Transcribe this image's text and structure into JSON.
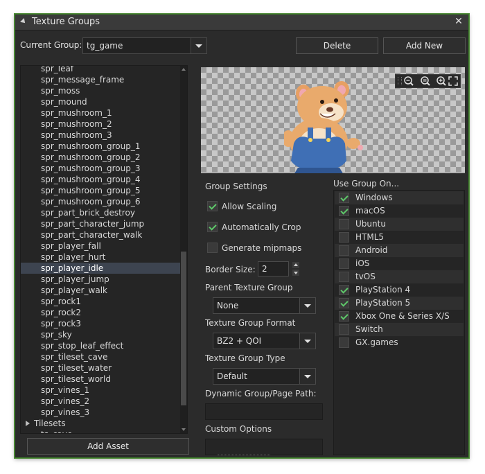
{
  "window": {
    "title": "Texture Groups"
  },
  "current_group": {
    "label": "Current Group:",
    "value": "tg_game"
  },
  "buttons": {
    "delete": "Delete",
    "add_new": "Add New",
    "add_asset": "Add Asset"
  },
  "assets": [
    "spr_leaf",
    "spr_message_frame",
    "spr_moss",
    "spr_mound",
    "spr_mushroom_1",
    "spr_mushroom_2",
    "spr_mushroom_3",
    "spr_mushroom_group_1",
    "spr_mushroom_group_2",
    "spr_mushroom_group_3",
    "spr_mushroom_group_4",
    "spr_mushroom_group_5",
    "spr_mushroom_group_6",
    "spr_part_brick_destroy",
    "spr_part_character_jump",
    "spr_part_character_walk",
    "spr_player_fall",
    "spr_player_hurt",
    "spr_player_idle",
    "spr_player_jump",
    "spr_player_walk",
    "spr_rock1",
    "spr_rock2",
    "spr_rock3",
    "spr_sky",
    "spr_stop_leaf_effect",
    "spr_tileset_cave",
    "spr_tileset_water",
    "spr_tileset_world",
    "spr_vines_1",
    "spr_vines_2",
    "spr_vines_3"
  ],
  "selected_asset": "spr_player_idle",
  "folder": {
    "label": "Tilesets"
  },
  "folder_child": "ts_cave",
  "settings": {
    "title": "Group Settings",
    "allow_scaling": {
      "label": "Allow Scaling",
      "checked": true
    },
    "auto_crop": {
      "label": "Automatically Crop",
      "checked": true
    },
    "mipmaps": {
      "label": "Generate mipmaps",
      "checked": false
    },
    "border_size": {
      "label": "Border Size:",
      "value": "2"
    },
    "parent_group": {
      "label": "Parent Texture Group",
      "value": "None"
    },
    "format": {
      "label": "Texture Group Format",
      "value": "BZ2 + QOI"
    },
    "type": {
      "label": "Texture Group Type",
      "value": "Default"
    },
    "dynamic_path": {
      "label": "Dynamic Group/Page Path:"
    },
    "custom_options": {
      "label": "Custom Options"
    }
  },
  "platforms": {
    "title": "Use Group On...",
    "items": [
      {
        "label": "Windows",
        "checked": true
      },
      {
        "label": "macOS",
        "checked": true
      },
      {
        "label": "Ubuntu",
        "checked": false
      },
      {
        "label": "HTML5",
        "checked": false
      },
      {
        "label": "Android",
        "checked": false
      },
      {
        "label": "iOS",
        "checked": false
      },
      {
        "label": "tvOS",
        "checked": false
      },
      {
        "label": "PlayStation 4",
        "checked": true
      },
      {
        "label": "PlayStation 5",
        "checked": true
      },
      {
        "label": "Xbox One & Series X/S",
        "checked": true
      },
      {
        "label": "Switch",
        "checked": false
      },
      {
        "label": "GX.games",
        "checked": false
      }
    ]
  },
  "colors": {
    "accent_green": "#5ec86a",
    "window_bg": "#2b2b2b",
    "selection": "#3d4450"
  },
  "icons": [
    "close-icon",
    "zoom-out-icon",
    "zoom-reset-icon",
    "zoom-in-icon",
    "fullscreen-icon"
  ]
}
